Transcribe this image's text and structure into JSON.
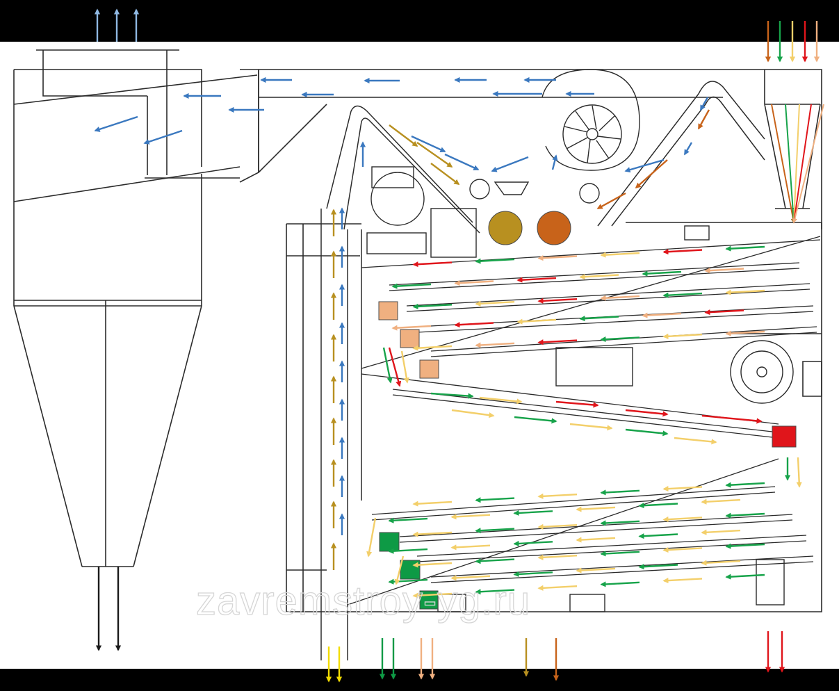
{
  "watermark": "zavremstroy-yg.ru",
  "colors": {
    "air": "#3a78bf",
    "air_light": "#8fb8e2",
    "dust": "#1a1a1a",
    "yellow": "#f2dc00",
    "light_yellow": "#f3cf6a",
    "green": "#17a34a",
    "red": "#e0151b",
    "peach": "#f0b080",
    "olive": "#b89020",
    "rust": "#c8631a",
    "dark_green": "#0e9a45",
    "line": "#2b2b2b"
  }
}
